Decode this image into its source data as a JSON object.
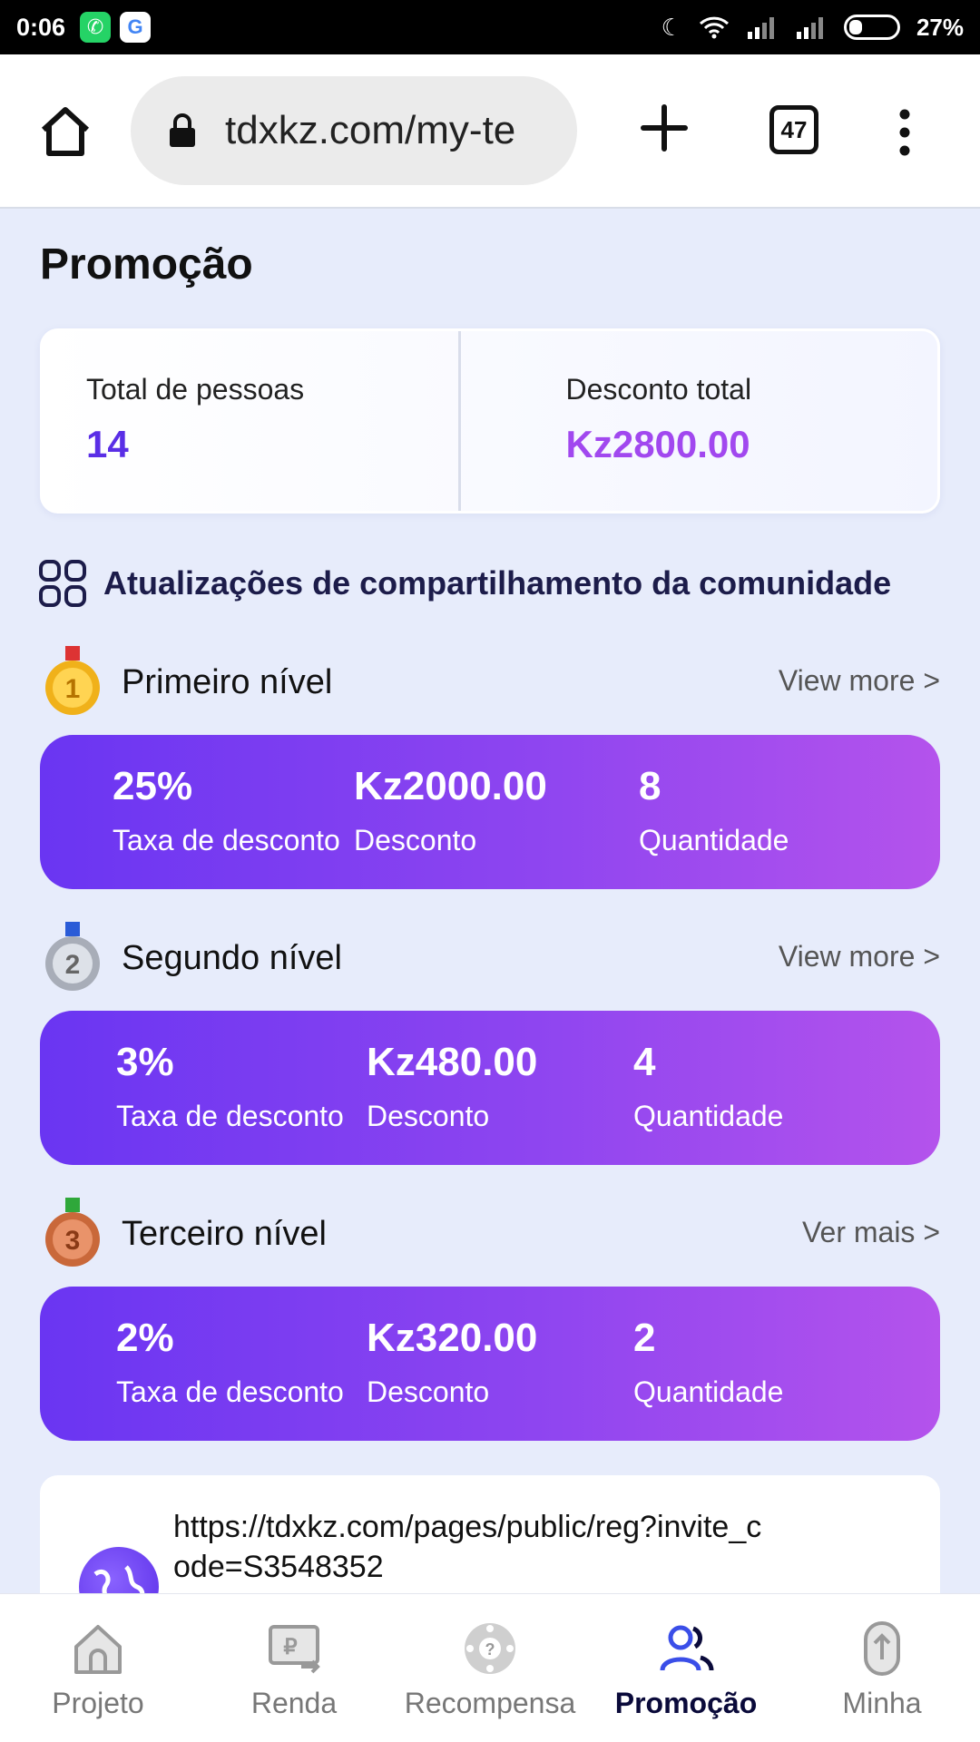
{
  "status_bar": {
    "time": "0:06",
    "battery": "27%"
  },
  "browser": {
    "url": "tdxkz.com/my-te",
    "tab_count": "47"
  },
  "page": {
    "title": "Promoção"
  },
  "summary": {
    "people_label": "Total de pessoas",
    "people_value": "14",
    "discount_label": "Desconto total",
    "discount_value": "Kz2800.00"
  },
  "section": {
    "title": "Atualizações de compartilhamento da comunidade"
  },
  "levels": [
    {
      "name": "Primeiro nível",
      "more": "View more >",
      "rate": "25%",
      "rate_label": "Taxa de desconto",
      "amount": "Kz2000.00",
      "amount_label": "Desconto",
      "qty": "8",
      "qty_label": "Quantidade",
      "medal_number": "1"
    },
    {
      "name": "Segundo nível",
      "more": "View more >",
      "rate": "3%",
      "rate_label": "Taxa de desconto",
      "amount": "Kz480.00",
      "amount_label": "Desconto",
      "qty": "4",
      "qty_label": "Quantidade",
      "medal_number": "2"
    },
    {
      "name": "Terceiro nível",
      "more": "Ver mais >",
      "rate": "2%",
      "rate_label": "Taxa de desconto",
      "amount": "Kz320.00",
      "amount_label": "Desconto",
      "qty": "2",
      "qty_label": "Quantidade",
      "medal_number": "3"
    }
  ],
  "invite": {
    "link": "https://tdxkz.com/pages/public/reg?invite_code=S3548352"
  },
  "nav": [
    {
      "label": "Projeto",
      "icon": "home-icon",
      "active": false
    },
    {
      "label": "Renda",
      "icon": "income-icon",
      "active": false
    },
    {
      "label": "Recompensa",
      "icon": "reward-wheel-icon",
      "active": false
    },
    {
      "label": "Promoção",
      "icon": "users-icon",
      "active": true
    },
    {
      "label": "Minha",
      "icon": "profile-icon",
      "active": false
    }
  ],
  "colors": {
    "accent": "#5a2ee6",
    "money": "#a148ef",
    "card_start": "#6a35f2",
    "card_end": "#b453ec"
  }
}
